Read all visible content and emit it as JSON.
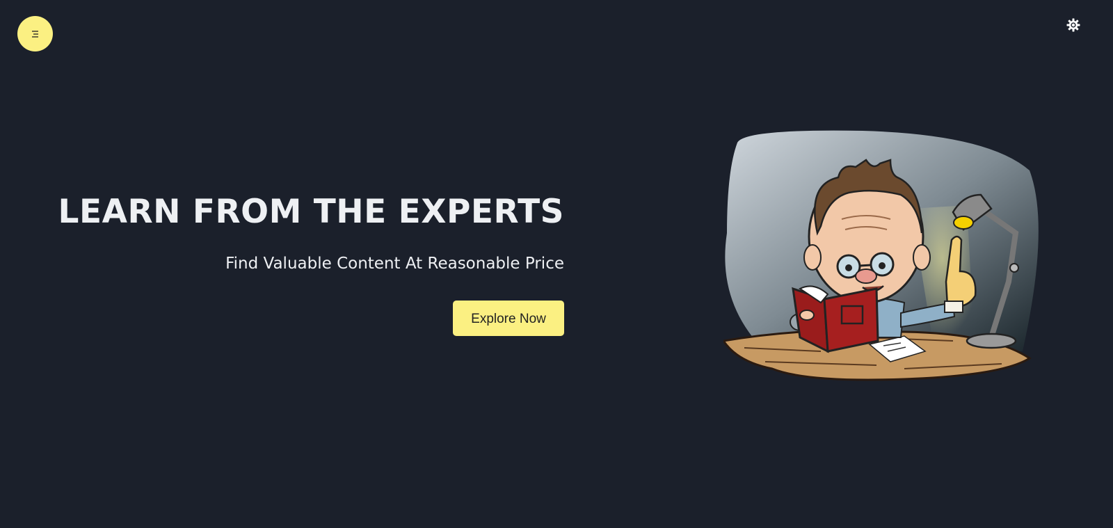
{
  "hero": {
    "title": "LEARN FROM THE EXPERTS",
    "subtitle": "Find Valuable Content At Reasonable Price",
    "cta_label": "Explore Now"
  },
  "icons": {
    "menu": "menu-icon",
    "theme": "sun-gear-icon"
  },
  "colors": {
    "background": "#1b202b",
    "accent": "#fbf082",
    "text": "#eef0f3"
  }
}
